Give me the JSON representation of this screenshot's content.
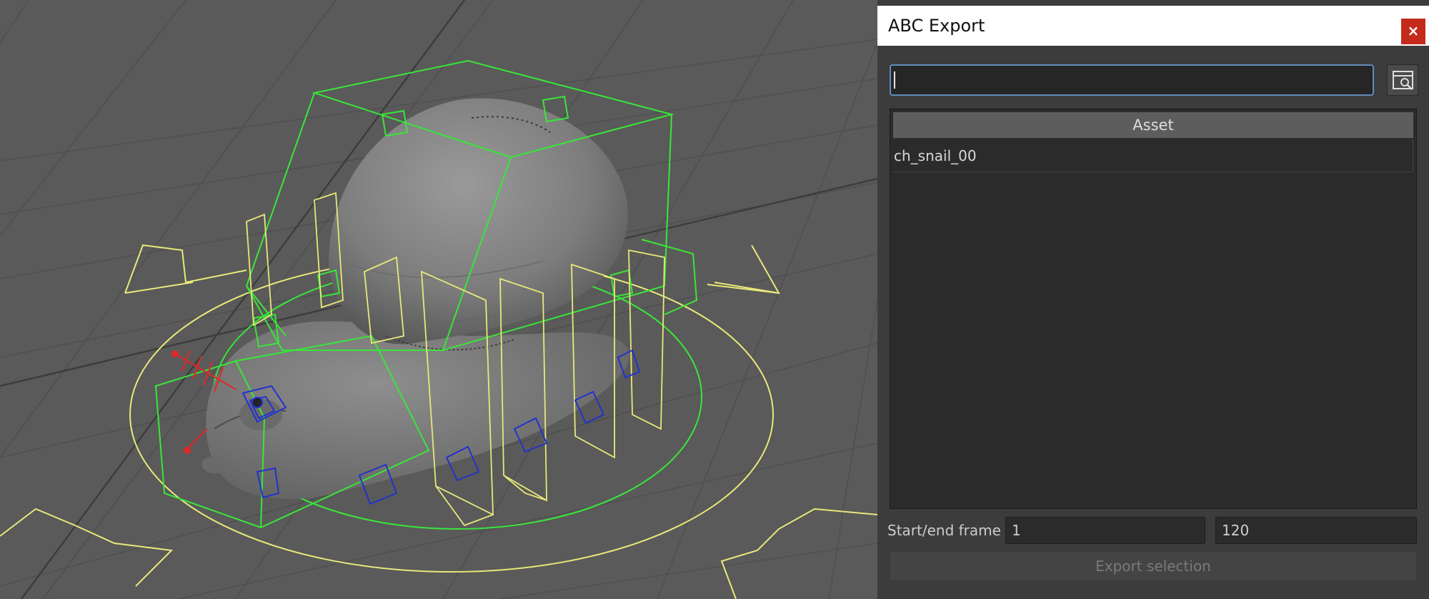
{
  "dialog": {
    "title": "ABC Export",
    "close_label": "×",
    "search": {
      "value": "",
      "placeholder": ""
    },
    "browse_icon": "browse-window-icon",
    "table": {
      "header": "Asset",
      "rows": [
        {
          "name": "ch_snail_00"
        }
      ]
    },
    "frame_range": {
      "label": "Start/end frame",
      "start": "1",
      "end": "120"
    },
    "export_label": "Export selection"
  },
  "viewport": {
    "background_color": "#5a5a5a",
    "grid_color": "#4e4e4e",
    "controls": {
      "green": "#39e639",
      "yellow": "#e8e87a",
      "blue": "#2233cc",
      "red": "#e02828"
    }
  },
  "colors": {
    "dialog_bg": "#3c3c3c",
    "close_bg": "#c42b1c",
    "input_focus_border": "#5f8db8",
    "table_header_bg": "#5d5d5d"
  }
}
